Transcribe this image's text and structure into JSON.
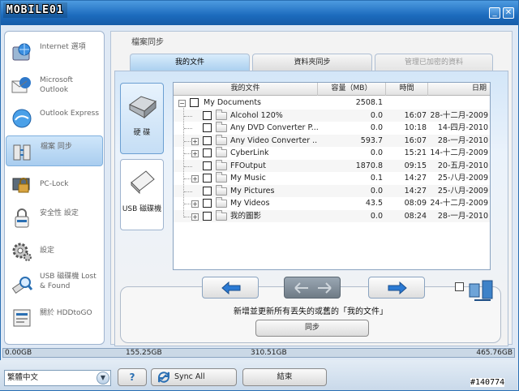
{
  "window": {
    "logo_text": "MOBILE01",
    "minimize": "_",
    "close": "✕"
  },
  "sidebar": {
    "items": [
      {
        "label": "Internet 選項",
        "icon": "internet-icon"
      },
      {
        "label": "Microsoft Outlook",
        "icon": "outlook-icon"
      },
      {
        "label": "Outlook Express",
        "icon": "outlook-express-icon"
      },
      {
        "label": "檔案 同步",
        "icon": "file-sync-icon"
      },
      {
        "label": "PC-Lock",
        "icon": "pc-lock-icon"
      },
      {
        "label": "安全性 設定",
        "icon": "security-icon"
      },
      {
        "label": "設定",
        "icon": "settings-icon"
      },
      {
        "label": "USB 磁碟機 Lost & Found",
        "icon": "usb-lost-found-icon"
      },
      {
        "label": "關於 HDDtoGO",
        "icon": "about-icon"
      }
    ]
  },
  "main": {
    "page_title": "檔案同步",
    "tabs": [
      {
        "label": "我的文件"
      },
      {
        "label": "資料夾同步"
      },
      {
        "label": "管理已加密的資料"
      }
    ],
    "devices": [
      {
        "label": "硬 碟"
      },
      {
        "label": "USB 磁碟機"
      }
    ],
    "tree": {
      "columns": {
        "name": "我的文件",
        "size": "容量（MB）",
        "time": "時間",
        "date": "日期"
      },
      "root": {
        "name": "My Documents",
        "size": "2508.1",
        "expander": "−"
      },
      "rows": [
        {
          "name": "Alcohol 120%",
          "size": "0.0",
          "time": "16:07",
          "date": "28-十二月-2009",
          "expander": ""
        },
        {
          "name": "Any DVD Converter P...",
          "size": "0.0",
          "time": "10:18",
          "date": "14-四月-2010",
          "expander": ""
        },
        {
          "name": "Any Video Converter ...",
          "size": "593.7",
          "time": "16:07",
          "date": "28-一月-2010",
          "expander": "+"
        },
        {
          "name": "CyberLink",
          "size": "0.0",
          "time": "15:21",
          "date": "14-十二月-2009",
          "expander": "+"
        },
        {
          "name": "FFOutput",
          "size": "1870.8",
          "time": "09:15",
          "date": "20-五月-2010",
          "expander": ""
        },
        {
          "name": "My Music",
          "size": "0.1",
          "time": "14:27",
          "date": "25-八月-2009",
          "expander": "+"
        },
        {
          "name": "My Pictures",
          "size": "0.0",
          "time": "14:27",
          "date": "25-八月-2009",
          "expander": ""
        },
        {
          "name": "My Videos",
          "size": "43.5",
          "time": "08:09",
          "date": "24-十二月-2009",
          "expander": "+"
        },
        {
          "name": "我的圖影",
          "size": "0.0",
          "time": "08:24",
          "date": "28-一月-2010",
          "expander": "+"
        }
      ]
    },
    "description": "新增並更新所有丟失的或舊的「我的文件」",
    "sync_button": "同步"
  },
  "status": {
    "ticks": [
      "0.00GB",
      "155.25GB",
      "310.51GB",
      "465.76GB"
    ]
  },
  "bottom": {
    "language": "繁體中文",
    "help_label": "?",
    "sync_all_label": "Sync All",
    "exit_label": "結束"
  },
  "watermark": "#140774",
  "colors": {
    "accent": "#2a6fb3",
    "titlebar": "#1c6bbd",
    "arrow": "#2b7ad3"
  }
}
